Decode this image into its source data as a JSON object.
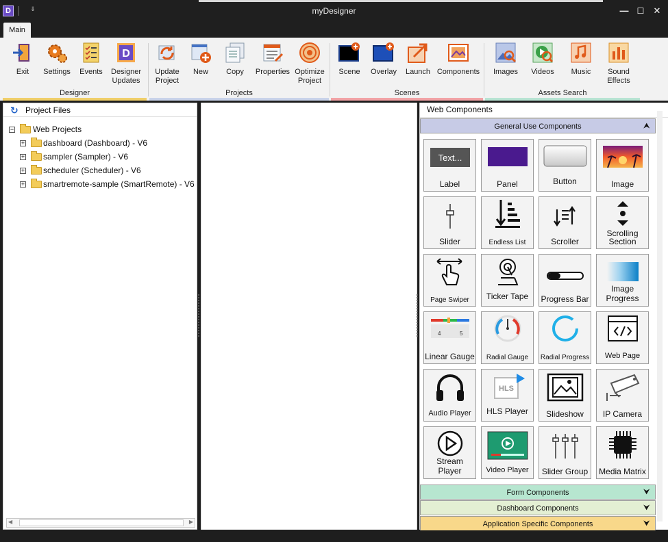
{
  "window": {
    "title": "myDesigner",
    "qa_glyph": "⇓",
    "min_glyph": "—",
    "max_glyph": "☐",
    "close_glyph": "✕",
    "logo": "D"
  },
  "tabs": [
    {
      "label": "Main"
    }
  ],
  "ribbon": {
    "groups": [
      {
        "label": "Designer",
        "color": "#f0cf6a",
        "buttons": [
          {
            "label": "Exit"
          },
          {
            "label": "Settings"
          },
          {
            "label": "Events"
          },
          {
            "label": "Designer Updates"
          }
        ]
      },
      {
        "label": "Projects",
        "color": "#c9d3ea",
        "buttons": [
          {
            "label": "Update Project"
          },
          {
            "label": "New"
          },
          {
            "label": "Copy"
          },
          {
            "label": "Properties"
          },
          {
            "label": "Optimize Project"
          }
        ]
      },
      {
        "label": "Scenes",
        "color": "#f2a3a6",
        "buttons": [
          {
            "label": "Scene"
          },
          {
            "label": "Overlay"
          },
          {
            "label": "Launch"
          },
          {
            "label": "Components"
          }
        ]
      },
      {
        "label": "Assets Search",
        "color": "#b8e4d3",
        "buttons": [
          {
            "label": "Images"
          },
          {
            "label": "Videos"
          },
          {
            "label": "Music"
          },
          {
            "label": "Sound Effects"
          }
        ]
      }
    ]
  },
  "project_files": {
    "title": "Project Files",
    "root": "Web Projects",
    "items": [
      {
        "label": "dashboard  (Dashboard) - V6"
      },
      {
        "label": "sampler  (Sampler) - V6"
      },
      {
        "label": "scheduler  (Scheduler) - V6"
      },
      {
        "label": "smartremote-sample  (SmartRemote) - V6"
      }
    ]
  },
  "web_components": {
    "title": "Web Components",
    "general": {
      "label": "General Use Components",
      "color": "#c7cbe6",
      "chevron": "⮝"
    },
    "tiles": [
      {
        "label": "Label",
        "icon": "label-icon",
        "thumb_text": "Text..."
      },
      {
        "label": "Panel",
        "icon": "panel-icon"
      },
      {
        "label": "Button",
        "icon": "button-icon"
      },
      {
        "label": "Image",
        "icon": "image-icon"
      },
      {
        "label": "Slider",
        "icon": "slider-icon"
      },
      {
        "label": "Endless List",
        "icon": "endless-list-icon"
      },
      {
        "label": "Scroller",
        "icon": "scroller-icon"
      },
      {
        "label": "Scrolling Section",
        "icon": "scrolling-section-icon"
      },
      {
        "label": "Page Swiper",
        "icon": "page-swiper-icon"
      },
      {
        "label": "Ticker Tape",
        "icon": "ticker-tape-icon"
      },
      {
        "label": "Progress Bar",
        "icon": "progress-bar-icon"
      },
      {
        "label": "Image Progress",
        "icon": "image-progress-icon"
      },
      {
        "label": "Linear Gauge",
        "icon": "linear-gauge-icon",
        "tick_a": "4",
        "tick_b": "5"
      },
      {
        "label": "Radial Gauge",
        "icon": "radial-gauge-icon"
      },
      {
        "label": "Radial Progress",
        "icon": "radial-progress-icon"
      },
      {
        "label": "Web Page",
        "icon": "web-page-icon"
      },
      {
        "label": "Audio Player",
        "icon": "audio-player-icon"
      },
      {
        "label": "HLS Player",
        "icon": "hls-player-icon",
        "badge": "HLS"
      },
      {
        "label": "Slideshow",
        "icon": "slideshow-icon"
      },
      {
        "label": "IP Camera",
        "icon": "ip-camera-icon"
      },
      {
        "label": "Stream Player",
        "icon": "stream-player-icon"
      },
      {
        "label": "Video Player",
        "icon": "video-player-icon"
      },
      {
        "label": "Slider Group",
        "icon": "slider-group-icon"
      },
      {
        "label": "Media Matrix",
        "icon": "media-matrix-icon"
      }
    ],
    "sections": [
      {
        "label": "Form Components",
        "color": "#b7e6d0",
        "chevron": "⮟"
      },
      {
        "label": "Dashboard Components",
        "color": "#e3efd3",
        "chevron": "⮟"
      },
      {
        "label": "Application Specific Components",
        "color": "#f8d88a",
        "chevron": "⮟"
      }
    ]
  }
}
